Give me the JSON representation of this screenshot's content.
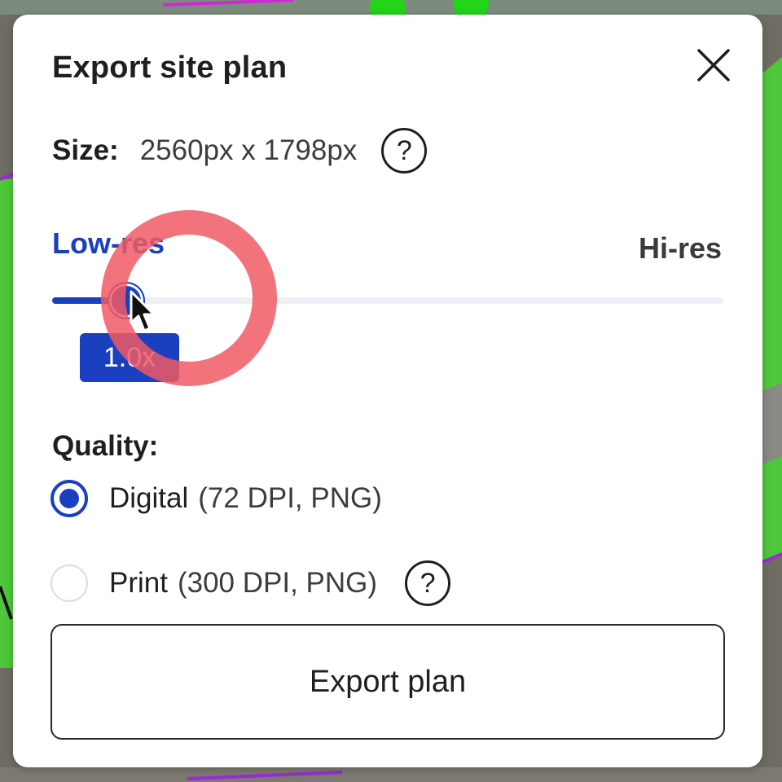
{
  "dialog": {
    "title": "Export site plan",
    "close_icon": "close-icon"
  },
  "size": {
    "label": "Size:",
    "value": "2560px x 1798px",
    "help_icon": "help-icon"
  },
  "resolution": {
    "low_label": "Low-res",
    "high_label": "Hi-res",
    "slider_value_label": "1.0x",
    "slider_fraction": 0.11
  },
  "quality": {
    "label": "Quality:",
    "options": [
      {
        "name": "Digital",
        "detail": "(72 DPI, PNG)",
        "selected": true
      },
      {
        "name": "Print",
        "detail": "(300 DPI, PNG)",
        "selected": false
      }
    ]
  },
  "export_button": {
    "label": "Export plan"
  },
  "colors": {
    "accent": "#1a3fbf",
    "click_indicator": "#f05a64"
  }
}
